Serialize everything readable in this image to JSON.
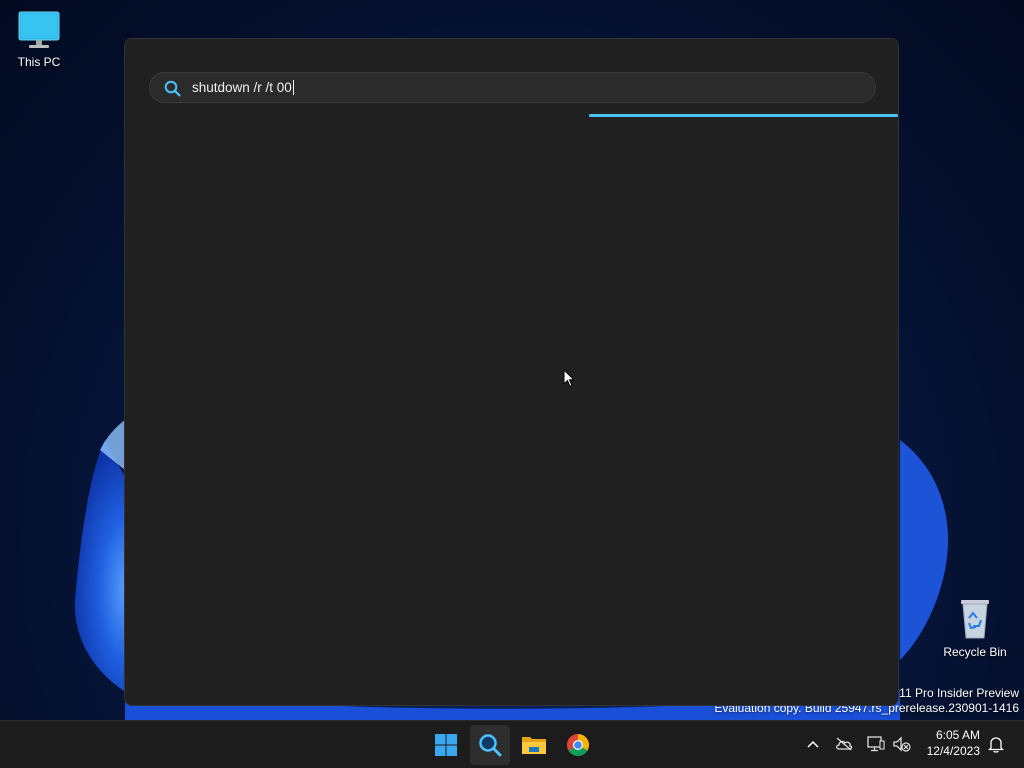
{
  "desktop": {
    "icons": [
      {
        "label": "This PC",
        "icon": "this-pc-icon"
      },
      {
        "label": "Recycle Bin",
        "icon": "recycle-bin-icon"
      }
    ],
    "watermark": {
      "line1": "s 11 Pro Insider Preview",
      "line2": "Evaluation copy. Build 25947.rs_prerelease.230901-1416"
    }
  },
  "search": {
    "query": "shutdown /r /t 00",
    "icon": "search-icon",
    "accent": "#4cc2ff",
    "loading_progress": 0.4
  },
  "taskbar": {
    "apps": [
      {
        "name": "Start",
        "icon": "windows-start-icon",
        "active": false
      },
      {
        "name": "Search",
        "icon": "search-icon",
        "active": true
      },
      {
        "name": "File Explorer",
        "icon": "folder-icon",
        "active": false
      },
      {
        "name": "Google Chrome",
        "icon": "chrome-icon",
        "active": false
      }
    ],
    "tray": {
      "icons": [
        "chevron-up-icon",
        "onedrive-offline-icon",
        "network-icon",
        "volume-muted-icon"
      ],
      "notification_icon": "bell-icon"
    },
    "clock": {
      "time": "6:05 AM",
      "date": "12/4/2023"
    }
  }
}
